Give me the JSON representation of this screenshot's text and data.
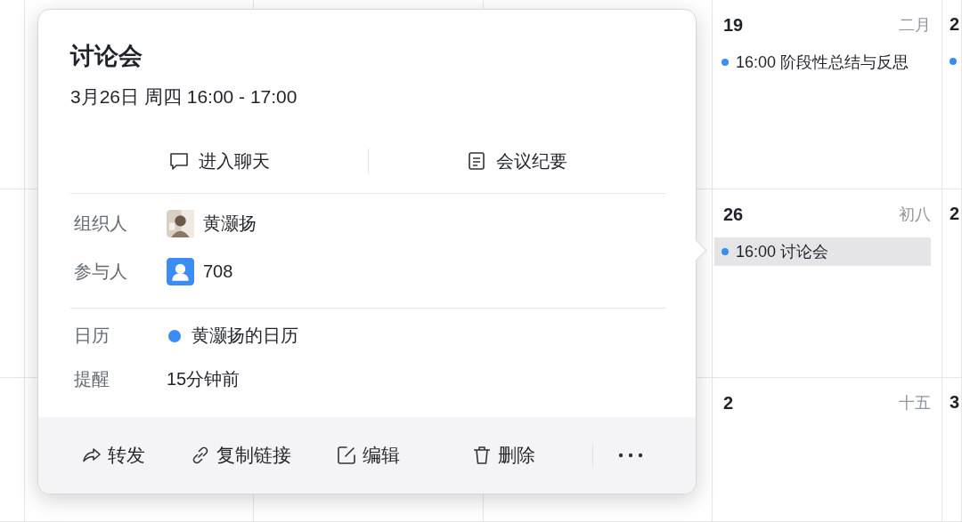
{
  "calendar": {
    "rows": [
      {
        "cell": {
          "date": "19",
          "lunar": "二月",
          "events": [
            {
              "time": "16:00",
              "title": "阶段性总结与反思",
              "color": "#3b8cf5",
              "selected": false
            }
          ]
        },
        "edge_cell": {
          "date": "2",
          "events": [
            {
              "color": "#3b8cf5"
            }
          ]
        }
      },
      {
        "cell": {
          "date": "26",
          "lunar": "初八",
          "events": [
            {
              "time": "16:00",
              "title": "讨论会",
              "color": "#3b8cf5",
              "selected": true
            }
          ]
        },
        "edge_cell": {
          "date": "2"
        }
      },
      {
        "cell": {
          "date": "2",
          "lunar": "十五"
        },
        "edge_cell": {
          "date": "3"
        }
      }
    ]
  },
  "popover": {
    "title": "讨论会",
    "time": "3月26日 周四 16:00 - 17:00",
    "actions": [
      {
        "label": "进入聊天"
      },
      {
        "label": "会议纪要"
      }
    ],
    "groups": [
      [
        {
          "label": "组织人",
          "kind": "person",
          "value": "黄灏扬"
        },
        {
          "label": "参与人",
          "kind": "group",
          "value": "708"
        }
      ],
      [
        {
          "label": "日历",
          "kind": "calendar",
          "value": "黄灏扬的日历",
          "color": "#3b8cf5"
        },
        {
          "label": "提醒",
          "kind": "text",
          "value": "15分钟前"
        }
      ]
    ],
    "footer": [
      {
        "label": "转发"
      },
      {
        "label": "复制链接"
      },
      {
        "label": "编辑"
      },
      {
        "label": "删除"
      }
    ]
  }
}
